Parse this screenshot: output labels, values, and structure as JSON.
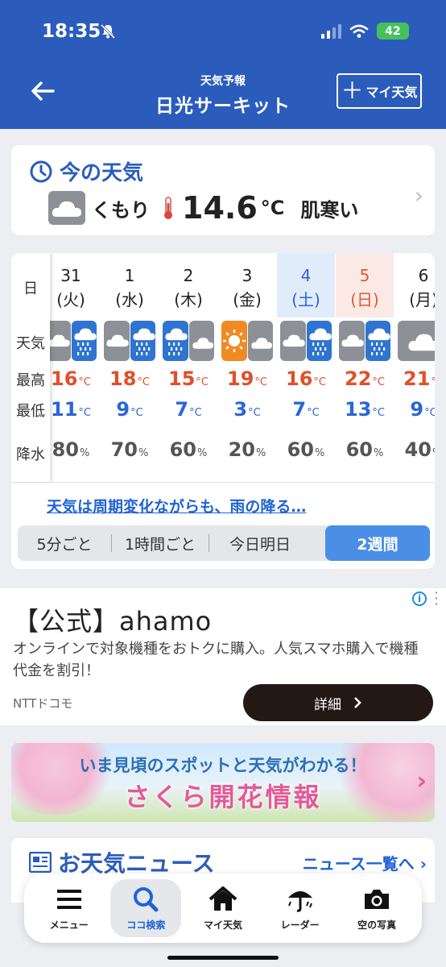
{
  "status_bar": {
    "time": "18:35",
    "battery": "42"
  },
  "header": {
    "subtitle": "天気予報",
    "title": "日光サーキット",
    "my_weather_label": "マイ天気"
  },
  "now": {
    "heading": "今の天気",
    "condition": "くもり",
    "temp": "14.6",
    "temp_unit": "°C",
    "feel": "肌寒い"
  },
  "forecast": {
    "row_labels": [
      "日",
      "天気",
      "最高",
      "最低",
      "降水"
    ],
    "days": [
      {
        "date": "31",
        "weekday": "(火)",
        "hi": "16",
        "lo": "11",
        "rain": "80",
        "icon": "cloudy-rain"
      },
      {
        "date": "1",
        "weekday": "(水)",
        "hi": "18",
        "lo": "9",
        "rain": "70",
        "icon": "cloudy-rain"
      },
      {
        "date": "2",
        "weekday": "(木)",
        "hi": "15",
        "lo": "7",
        "rain": "60",
        "icon": "rain-cloudy"
      },
      {
        "date": "3",
        "weekday": "(金)",
        "hi": "19",
        "lo": "3",
        "rain": "20",
        "icon": "sunny-cloudy"
      },
      {
        "date": "4",
        "weekday": "(土)",
        "hi": "16",
        "lo": "7",
        "rain": "60",
        "icon": "cloudy-rain"
      },
      {
        "date": "5",
        "weekday": "(日)",
        "hi": "22",
        "lo": "13",
        "rain": "60",
        "icon": "cloudy-rain"
      },
      {
        "date": "6",
        "weekday": "(月)",
        "hi": "21",
        "lo": "9",
        "rain": "40",
        "icon": "cloudy"
      }
    ],
    "unit_c": "°C",
    "unit_pct": "%",
    "summary": "天気は周期変化ながらも、雨の降る…",
    "tabs": [
      "5分ごと",
      "1時間ごと",
      "今日明日",
      "2週間"
    ],
    "active_tab": "2週間"
  },
  "ad": {
    "title": "【公式】ahamo",
    "description": "オンラインで対象機種をおトクに購入。人気スマホ購入で機種代金を割引！",
    "advertiser": "NTTドコモ",
    "cta": "詳細"
  },
  "banner": {
    "subtitle": "いま見頃のスポットと天気がわかる！",
    "title": "さくら開花情報"
  },
  "news": {
    "heading": "お天気ニュース",
    "link": "ニュース一覧へ"
  },
  "bottom_nav": [
    {
      "label": "メニュー",
      "icon": "menu-icon"
    },
    {
      "label": "ココ検索",
      "icon": "search-icon"
    },
    {
      "label": "マイ天気",
      "icon": "home-icon"
    },
    {
      "label": "レーダー",
      "icon": "umbrella-radar-icon"
    },
    {
      "label": "空の写真",
      "icon": "camera-icon"
    }
  ],
  "colors": {
    "header_blue": "#2b5cbc",
    "high_temp": "#e0502a",
    "low_temp": "#2b66d6",
    "active_tab": "#4a8ee6"
  }
}
